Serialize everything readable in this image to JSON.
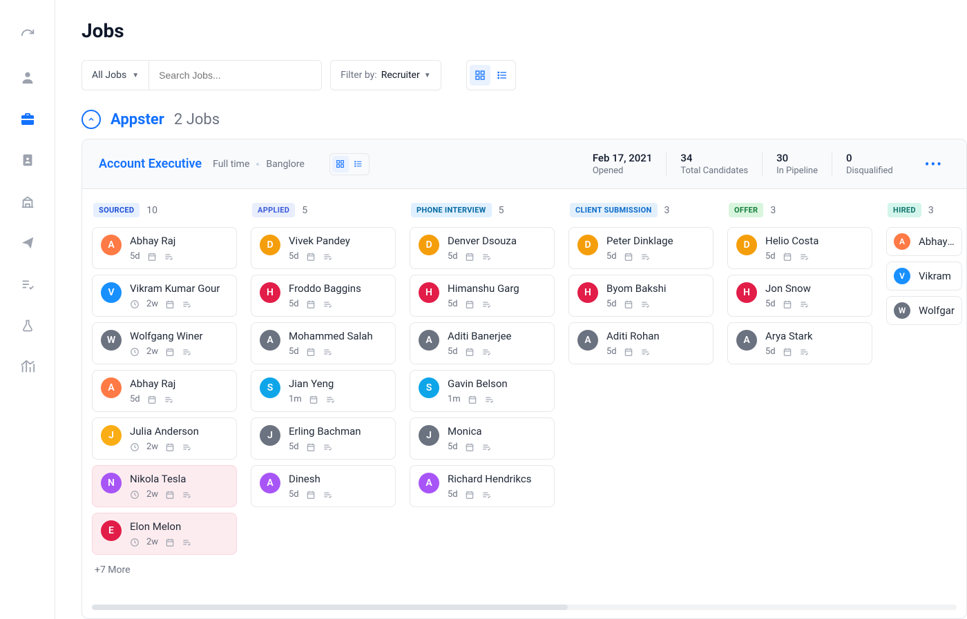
{
  "page_title": "Jobs",
  "filters": {
    "all_jobs_label": "All Jobs",
    "search_placeholder": "Search Jobs...",
    "filter_by_label": "Filter by:",
    "filter_by_value": "Recruiter"
  },
  "group": {
    "name": "Appster",
    "count_label": "2 Jobs"
  },
  "job": {
    "title": "Account Executive",
    "type": "Full time",
    "location": "Banglore",
    "stats": [
      {
        "value": "Feb 17, 2021",
        "label": "Opened"
      },
      {
        "value": "34",
        "label": "Total Candidates"
      },
      {
        "value": "30",
        "label": "In Pipeline"
      },
      {
        "value": "0",
        "label": "Disqualified"
      }
    ]
  },
  "columns": [
    {
      "name": "SOURCED",
      "count": "10",
      "pill": "blue1",
      "cards": [
        {
          "initial": "A",
          "color": "av-orange",
          "name": "Abhay Raj",
          "time": "5d",
          "clock": false,
          "bg": ""
        },
        {
          "initial": "V",
          "color": "av-blue",
          "name": "Vikram Kumar Gour",
          "time": "2w",
          "clock": true,
          "bg": ""
        },
        {
          "initial": "W",
          "color": "av-grey",
          "name": "Wolfgang Winer",
          "time": "2w",
          "clock": true,
          "bg": ""
        },
        {
          "initial": "A",
          "color": "av-orange",
          "name": "Abhay Raj",
          "time": "5d",
          "clock": false,
          "bg": ""
        },
        {
          "initial": "J",
          "color": "av-yellow",
          "name": "Julia Anderson",
          "time": "2w",
          "clock": true,
          "bg": ""
        },
        {
          "initial": "N",
          "color": "av-purple",
          "name": "Nikola Tesla",
          "time": "2w",
          "clock": true,
          "bg": "pink"
        },
        {
          "initial": "E",
          "color": "av-red",
          "name": "Elon Melon",
          "time": "2w",
          "clock": true,
          "bg": "pink"
        }
      ],
      "more": "+7 More"
    },
    {
      "name": "APPLIED",
      "count": "5",
      "pill": "blue2",
      "cards": [
        {
          "initial": "D",
          "color": "av-dorange",
          "name": "Vivek Pandey",
          "time": "5d",
          "clock": false,
          "bg": ""
        },
        {
          "initial": "H",
          "color": "av-red",
          "name": "Froddo Baggins",
          "time": "5d",
          "clock": false,
          "bg": ""
        },
        {
          "initial": "A",
          "color": "av-grey",
          "name": "Mohammed Salah",
          "time": "5d",
          "clock": false,
          "bg": ""
        },
        {
          "initial": "S",
          "color": "av-skyblue",
          "name": "Jian Yeng",
          "time": "1m",
          "clock": false,
          "bg": ""
        },
        {
          "initial": "J",
          "color": "av-grey",
          "name": "Erling Bachman",
          "time": "5d",
          "clock": false,
          "bg": ""
        },
        {
          "initial": "A",
          "color": "av-purple",
          "name": "Dinesh",
          "time": "5d",
          "clock": false,
          "bg": ""
        }
      ]
    },
    {
      "name": "PHONE INTERVIEW",
      "count": "5",
      "pill": "blue3",
      "cards": [
        {
          "initial": "D",
          "color": "av-dorange",
          "name": "Denver Dsouza",
          "time": "5d",
          "clock": false,
          "bg": ""
        },
        {
          "initial": "H",
          "color": "av-red",
          "name": "Himanshu Garg",
          "time": "5d",
          "clock": false,
          "bg": ""
        },
        {
          "initial": "A",
          "color": "av-grey",
          "name": "Aditi Banerjee",
          "time": "5d",
          "clock": false,
          "bg": ""
        },
        {
          "initial": "S",
          "color": "av-skyblue",
          "name": "Gavin Belson",
          "time": "1m",
          "clock": false,
          "bg": ""
        },
        {
          "initial": "J",
          "color": "av-grey",
          "name": "Monica",
          "time": "5d",
          "clock": false,
          "bg": ""
        },
        {
          "initial": "A",
          "color": "av-purple",
          "name": "Richard Hendrikcs",
          "time": "5d",
          "clock": false,
          "bg": ""
        }
      ]
    },
    {
      "name": "CLIENT SUBMISSION",
      "count": "3",
      "pill": "blue4",
      "cards": [
        {
          "initial": "D",
          "color": "av-dorange",
          "name": "Peter Dinklage",
          "time": "5d",
          "clock": false,
          "bg": ""
        },
        {
          "initial": "H",
          "color": "av-red",
          "name": "Byom Bakshi",
          "time": "5d",
          "clock": false,
          "bg": ""
        },
        {
          "initial": "A",
          "color": "av-grey",
          "name": "Aditi Rohan",
          "time": "5d",
          "clock": false,
          "bg": ""
        }
      ]
    },
    {
      "name": "OFFER",
      "count": "3",
      "pill": "green",
      "cards": [
        {
          "initial": "D",
          "color": "av-dorange",
          "name": "Helio Costa",
          "time": "5d",
          "clock": false,
          "bg": ""
        },
        {
          "initial": "H",
          "color": "av-red",
          "name": "Jon Snow",
          "time": "5d",
          "clock": false,
          "bg": ""
        },
        {
          "initial": "A",
          "color": "av-grey",
          "name": "Arya Stark",
          "time": "5d",
          "clock": false,
          "bg": ""
        }
      ]
    },
    {
      "name": "HIRED",
      "count": "3",
      "pill": "teal",
      "compact": true,
      "cards": [
        {
          "initial": "A",
          "color": "av-orange",
          "name": "Abhay R",
          "time": "",
          "clock": false,
          "bg": ""
        },
        {
          "initial": "V",
          "color": "av-blue",
          "name": "Vikram",
          "time": "",
          "clock": false,
          "bg": ""
        },
        {
          "initial": "W",
          "color": "av-grey",
          "name": "Wolfgar",
          "time": "",
          "clock": false,
          "bg": ""
        }
      ]
    }
  ]
}
